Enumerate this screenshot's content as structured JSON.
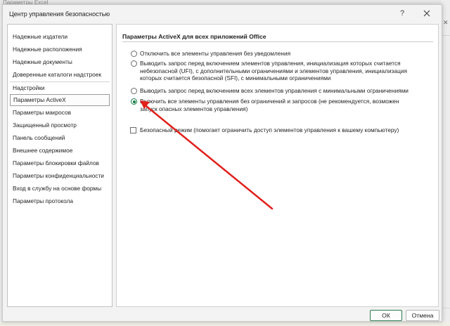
{
  "background": {
    "top_text": "Параметры Excel"
  },
  "dialog": {
    "title": "Центр управления безопасностью",
    "help_label": "?",
    "close_icon": "close-icon"
  },
  "nav": {
    "items": [
      "Надежные издатели",
      "Надежные расположения",
      "Надежные документы",
      "Доверенные каталоги надстроек",
      "Надстройки",
      "Параметры ActiveX",
      "Параметры макросов",
      "Защищенный просмотр",
      "Панель сообщений",
      "Внешнее содержимое",
      "Параметры блокировки файлов",
      "Параметры конфиденциальности",
      "Вход в службу на основе формы",
      "Параметры протокола"
    ],
    "selected_index": 5
  },
  "panel": {
    "section_title": "Параметры ActiveX для всех приложений Office",
    "options": [
      {
        "label": "Отключить все элементы управления без уведомления",
        "checked": false
      },
      {
        "label": "Выводить запрос перед включением элементов управления, инициализация которых считается небезопасной (UFI), с дополнительными ограничениями и элементов управления, инициализация которых считается безопасной (SFI), с минимальными ограничениями",
        "checked": false
      },
      {
        "label": "Выводить запрос перед включением всех элементов управления с минимальными ограничениями",
        "checked": false
      },
      {
        "label": "Включить все элементы управления без ограничений и запросов (не рекомендуется, возможен запуск опасных элементов управления)",
        "checked": true
      }
    ],
    "safe_mode": {
      "label": "Безопасный режим (помогает ограничить доступ элементов управления к вашему компьютеру)",
      "checked": false
    }
  },
  "buttons": {
    "ok": "ОК",
    "cancel": "Отмена"
  },
  "colors": {
    "accent": "#107c41",
    "arrow": "#e0201b"
  }
}
